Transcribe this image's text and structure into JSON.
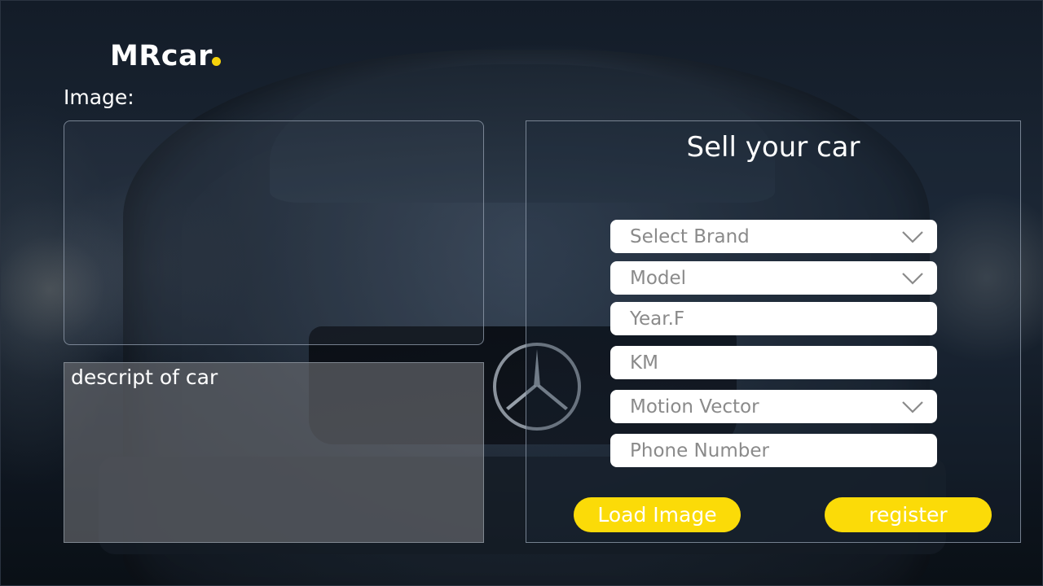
{
  "brand": {
    "name": "MRcar"
  },
  "image_section": {
    "label": "Image:"
  },
  "description": {
    "text": "descript of car"
  },
  "form": {
    "title": "Sell your car",
    "fields": [
      {
        "placeholder": "Select Brand",
        "type": "dropdown",
        "icon": "chevron-down-icon"
      },
      {
        "placeholder": "Model",
        "type": "dropdown",
        "icon": "chevron-down-icon"
      },
      {
        "placeholder": "Year.F",
        "type": "text"
      },
      {
        "placeholder": "KM",
        "type": "text"
      },
      {
        "placeholder": "Motion Vector",
        "type": "dropdown",
        "icon": "chevron-down-icon"
      },
      {
        "placeholder": "Phone Number",
        "type": "text"
      }
    ],
    "load_image_label": "Load Image",
    "register_label": "register"
  },
  "colors": {
    "accent": "#fbdb08",
    "logo_dot": "#f5d20b",
    "background": "#0d1521",
    "field_text": "#8a8a8a"
  }
}
